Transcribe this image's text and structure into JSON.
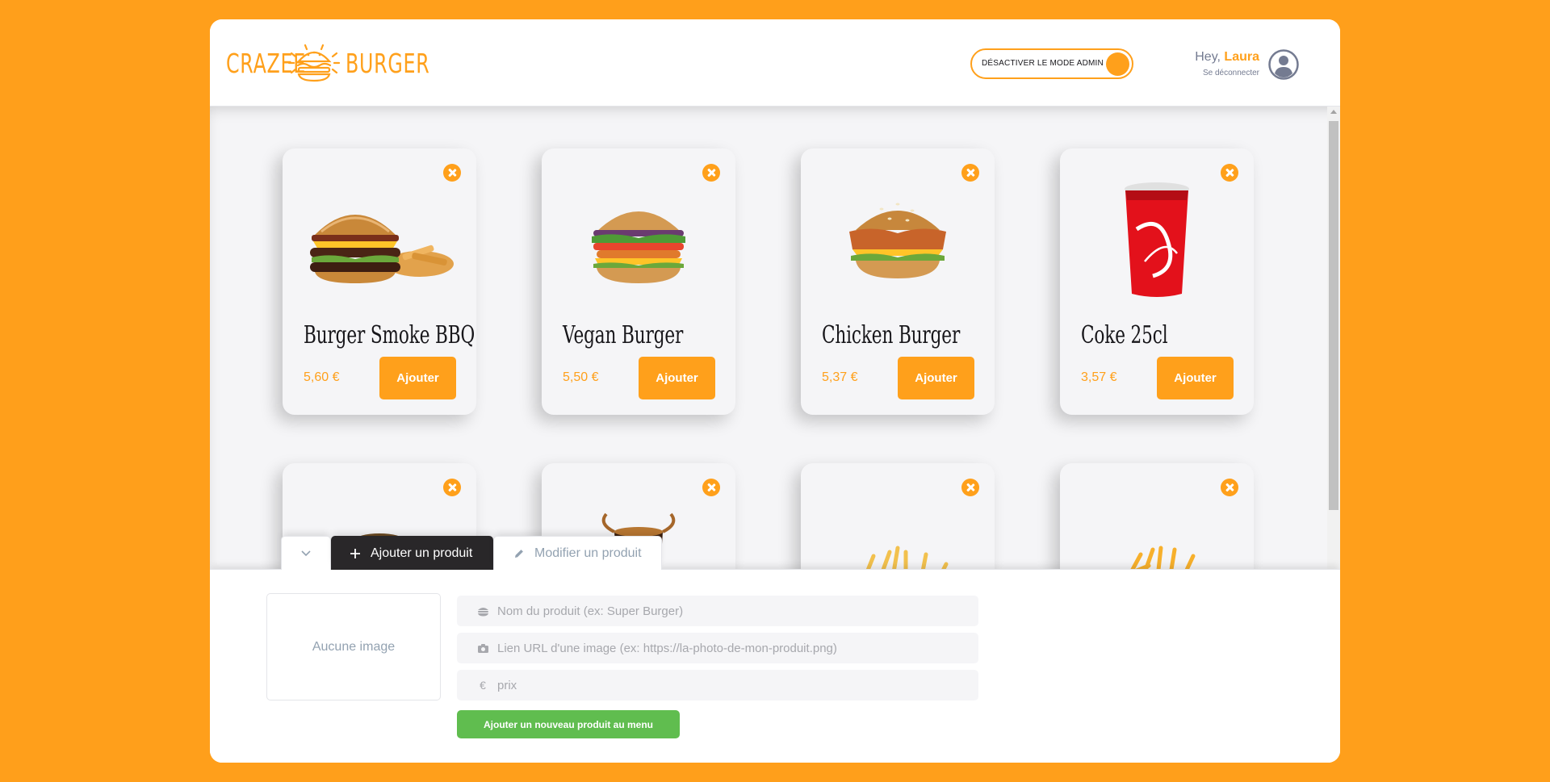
{
  "brand": {
    "word1": "CRAZEE",
    "word2": "BURGER",
    "color": "#ffa01b"
  },
  "navbar": {
    "admin_toggle_label": "DÉSACTIVER LE MODE ADMIN",
    "greeting": "Hey,",
    "user_name": "Laura",
    "logout": "Se déconnecter"
  },
  "menu": {
    "products": [
      {
        "title": "Burger Smoke BBQ",
        "price": "5,60 €",
        "add_label": "Ajouter",
        "image": "burger-bbq"
      },
      {
        "title": "Vegan Burger",
        "price": "5,50 €",
        "add_label": "Ajouter",
        "image": "vegan-burger"
      },
      {
        "title": "Chicken Burger",
        "price": "5,37 €",
        "add_label": "Ajouter",
        "image": "chicken-burger"
      },
      {
        "title": "Coke 25cl",
        "price": "3,57 €",
        "add_label": "Ajouter",
        "image": "coke-cup"
      },
      {
        "title": "",
        "price": "",
        "add_label": "",
        "image": "blue-cup"
      },
      {
        "title": "",
        "price": "",
        "add_label": "",
        "image": "cola-glass"
      },
      {
        "title": "",
        "price": "",
        "add_label": "",
        "image": "fries-bowl"
      },
      {
        "title": "",
        "price": "",
        "add_label": "",
        "image": "fries-board"
      }
    ]
  },
  "admin": {
    "tabs": {
      "add": "Ajouter un produit",
      "edit": "Modifier un produit"
    },
    "preview_empty": "Aucune image",
    "fields": {
      "name_placeholder": "Nom du produit (ex: Super Burger)",
      "image_placeholder": "Lien URL d'une image (ex: https://la-photo-de-mon-produit.png)",
      "price_placeholder": "prix"
    },
    "submit_label": "Ajouter un nouveau produit au menu",
    "euro_symbol": "€"
  },
  "colors": {
    "primary": "#ffa01b",
    "success": "#60bd4f",
    "dark": "#292729",
    "background": "#f5f5f7"
  }
}
